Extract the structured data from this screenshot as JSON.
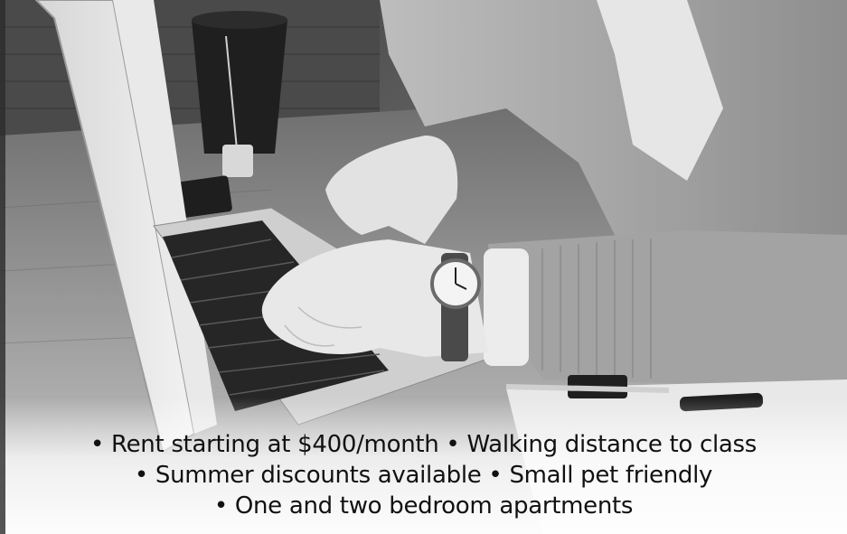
{
  "photo": {
    "subject": "person typing on a laptop at a wooden desk, wristwatch, mug, pens, grayscale"
  },
  "bullet": "•",
  "amenities": [
    {
      "items": [
        "Rent starting at $400/month",
        "Walking distance to class"
      ]
    },
    {
      "items": [
        "Summer discounts available",
        "Small pet friendly"
      ]
    },
    {
      "items": [
        "One and two bedroom apartments"
      ]
    }
  ]
}
